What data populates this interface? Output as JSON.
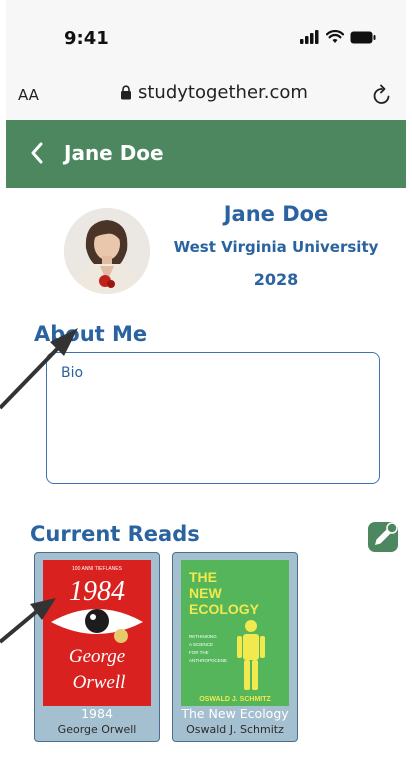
{
  "status": {
    "time": "9:41"
  },
  "browser": {
    "text_size_label": "AA",
    "url": "studytogether.com"
  },
  "nav": {
    "title": "Jane Doe"
  },
  "profile": {
    "name": "Jane Doe",
    "university": "West Virginia University",
    "year": "2028"
  },
  "about": {
    "heading": "About Me",
    "bio_placeholder": "Bio"
  },
  "reads": {
    "heading": "Current Reads",
    "books": [
      {
        "title": "1984",
        "author": "George Orwell",
        "cover_top": "100 ANNI TIEFLANES",
        "cover_title": "1984",
        "cover_author_line1": "George",
        "cover_author_line2": "Orwell"
      },
      {
        "title": "The New Ecology",
        "author": "Oswald J. Schmitz",
        "cover_title_line1": "THE",
        "cover_title_line2": "NEW",
        "cover_title_line3": "ECOLOGY",
        "cover_subtitle_line1": "RETHINKING",
        "cover_subtitle_line2": "A SCIENCE",
        "cover_subtitle_line3": "FOR THE",
        "cover_subtitle_line4": "ANTHROPOCENE",
        "cover_author": "OSWALD J. SCHMITZ"
      }
    ]
  },
  "colors": {
    "accent_green": "#4c8760",
    "accent_blue": "#2a63a0",
    "card_bg": "#a4bfd0"
  }
}
